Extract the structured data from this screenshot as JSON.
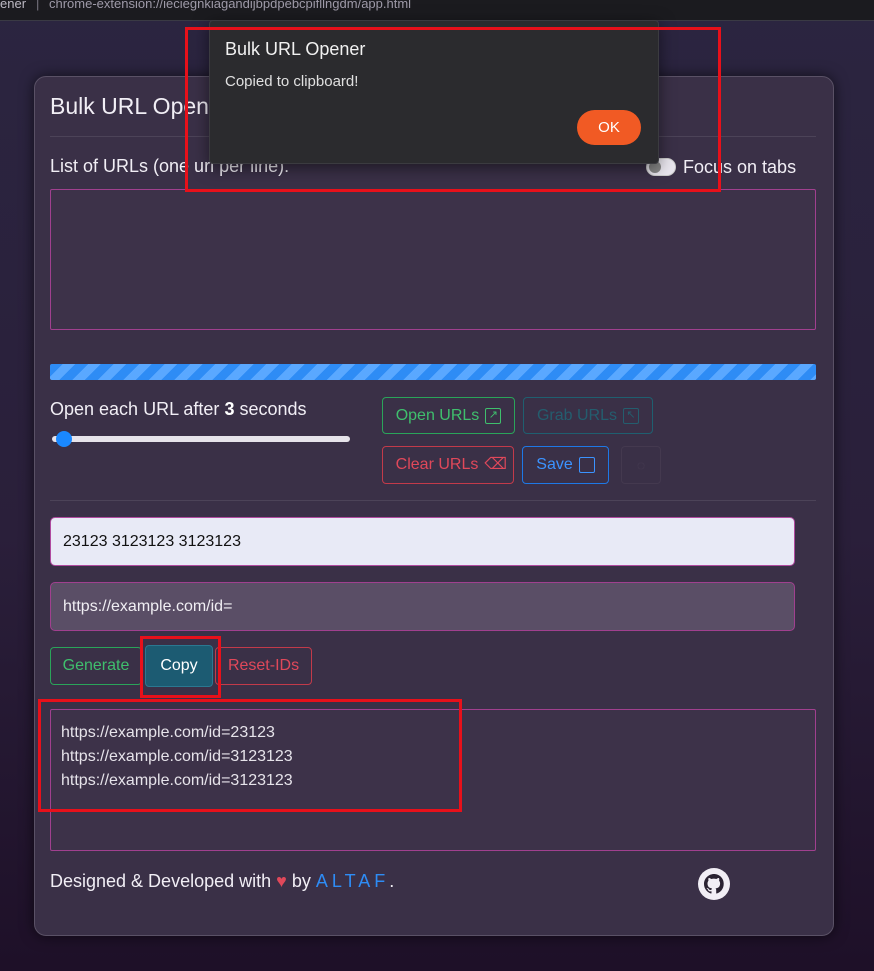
{
  "browser": {
    "tab_fragment": "ener",
    "separator": "|",
    "url": "chrome-extension://ieciegnkiagandijbpdpebcpifllngdm/app.html"
  },
  "app": {
    "title": "Bulk URL Open",
    "list_label": "List of URLs (one url per line):",
    "focus_toggle_label": "Focus on tabs",
    "focus_toggle_on": false,
    "urls_value": "",
    "delay_prefix": "Open each URL after",
    "delay_value": "3",
    "delay_suffix": "seconds"
  },
  "buttons": {
    "open": "Open URLs",
    "grab": "Grab URLs",
    "clear": "Clear URLs",
    "save": "Save",
    "generate": "Generate",
    "copy": "Copy",
    "reset": "Reset-IDs"
  },
  "generator": {
    "ids_value": "23123 3123123 3123123",
    "prefix_value": "https://example.com/id=",
    "output_lines": [
      "https://example.com/id=23123",
      "https://example.com/id=3123123",
      "https://example.com/id=3123123"
    ]
  },
  "footer": {
    "text": "Designed & Developed with",
    "heart": "♥",
    "by": "by",
    "author": "ALTAF",
    "period": "."
  },
  "dialog": {
    "title": "Bulk URL Opener",
    "message": "Copied to clipboard!",
    "ok_label": "OK"
  },
  "colors": {
    "accent_blue": "#2e8cf5",
    "success_green": "#3fbf6d",
    "danger_red": "#e0485a",
    "dialog_ok": "#f15a24",
    "highlight_red": "#e8101a"
  }
}
